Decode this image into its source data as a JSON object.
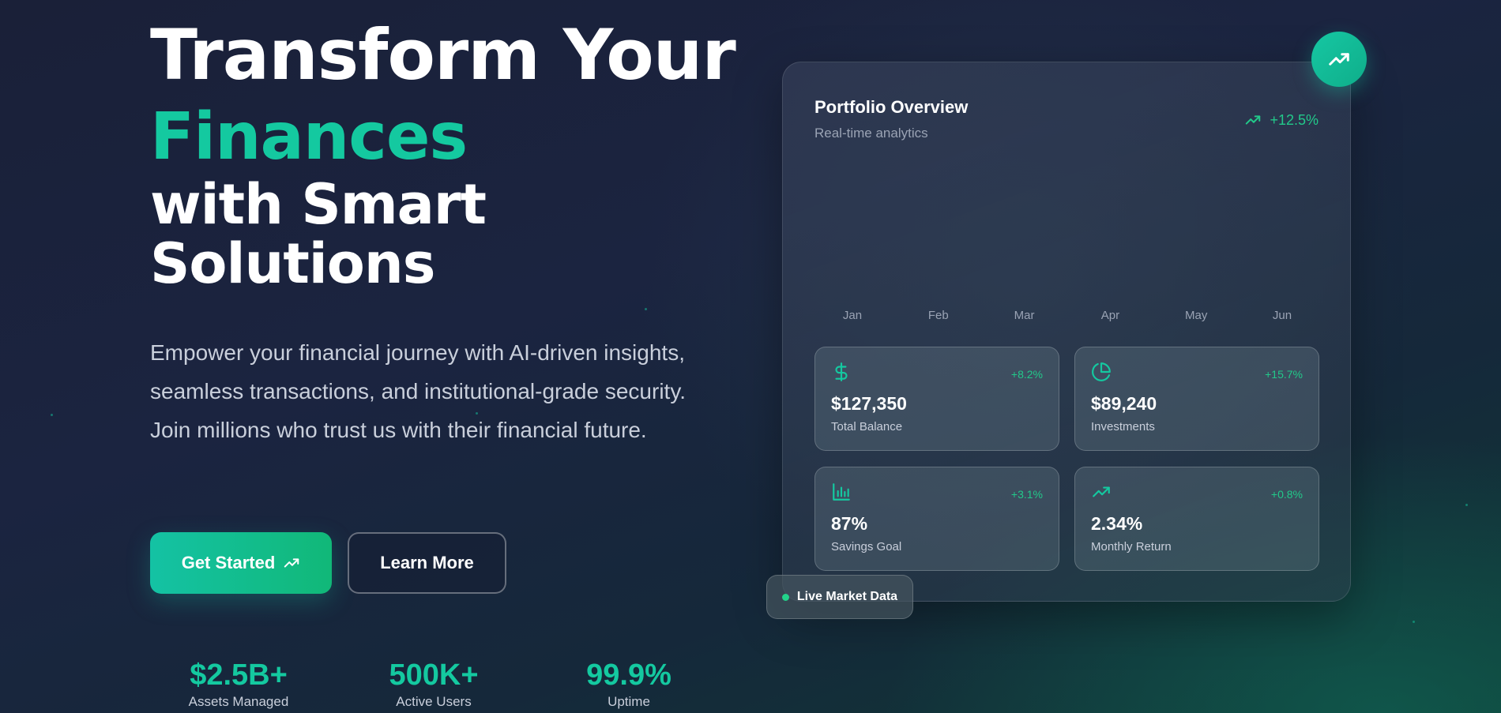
{
  "hero": {
    "title_line1": "Transform Your",
    "title_line2": "Finances",
    "title_line3": "with Smart",
    "title_line4": "Solutions",
    "subtitle": "Empower your financial journey with AI-driven insights, seamless transactions, and institutional-grade security. Join millions who trust us with their financial future."
  },
  "buttons": {
    "primary_label": "Get Started",
    "secondary_label": "Learn More"
  },
  "stats": [
    {
      "value": "$2.5B+",
      "label": "Assets Managed"
    },
    {
      "value": "500K+",
      "label": "Active Users"
    },
    {
      "value": "99.9%",
      "label": "Uptime"
    }
  ],
  "portfolio": {
    "title": "Portfolio Overview",
    "subtitle": "Real-time analytics",
    "change": "+12.5%",
    "months": [
      "Jan",
      "Feb",
      "Mar",
      "Apr",
      "May",
      "Jun"
    ],
    "metrics": [
      {
        "icon": "dollar-icon",
        "value": "$127,350",
        "label": "Total Balance",
        "change": "+8.2%"
      },
      {
        "icon": "pie-chart-icon",
        "value": "$89,240",
        "label": "Investments",
        "change": "+15.7%"
      },
      {
        "icon": "bar-chart-icon",
        "value": "87%",
        "label": "Savings Goal",
        "change": "+3.1%"
      },
      {
        "icon": "trending-up-icon",
        "value": "2.34%",
        "label": "Monthly Return",
        "change": "+0.8%"
      }
    ]
  },
  "badge": {
    "live_label": "Live Market Data"
  },
  "colors": {
    "accent": "#14c9a0",
    "positive": "#22c98a",
    "background": "#1a2038"
  }
}
